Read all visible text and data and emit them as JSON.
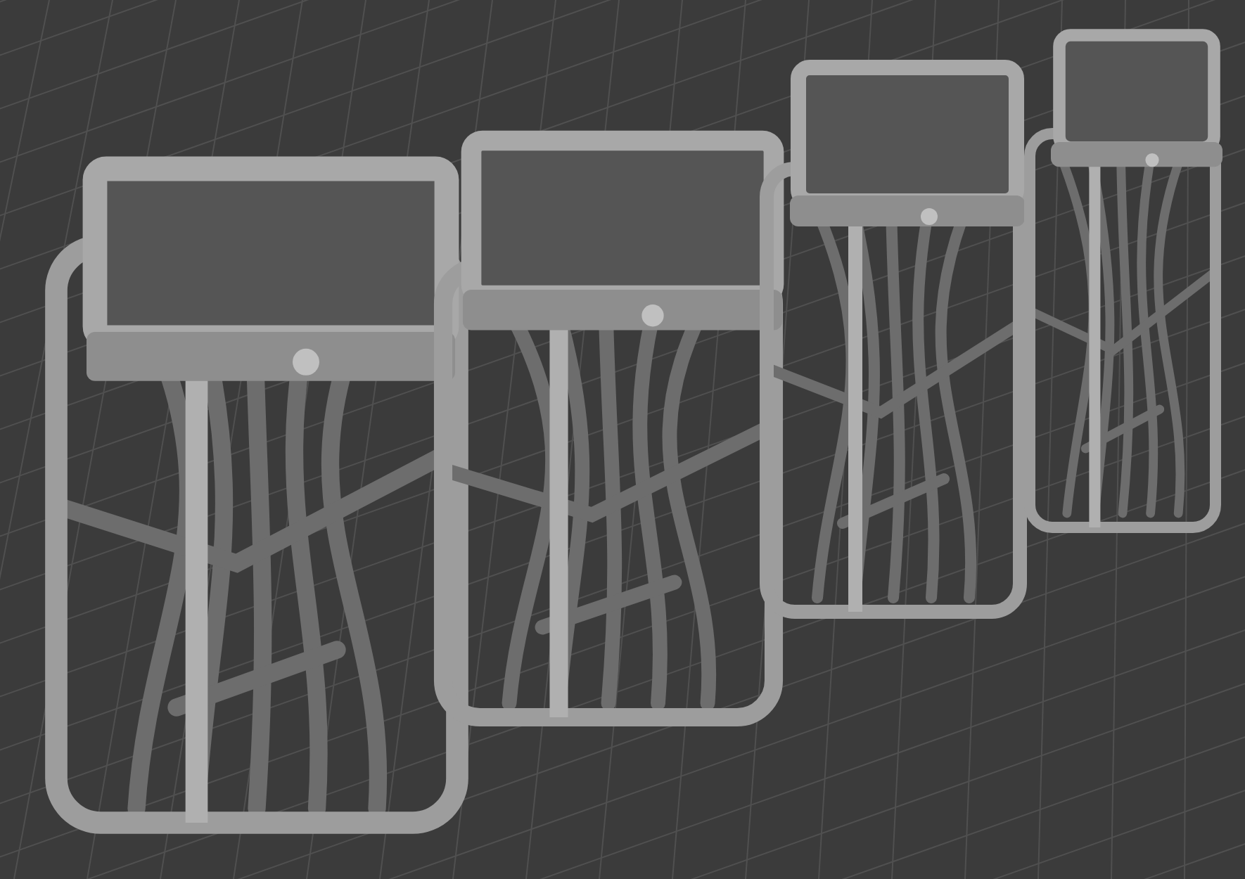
{
  "viewport": {
    "grid": true,
    "models": [
      {
        "kind": "lattice"
      },
      {
        "kind": "lattice"
      },
      {
        "kind": "lattice"
      },
      {
        "kind": "lattice"
      }
    ]
  }
}
